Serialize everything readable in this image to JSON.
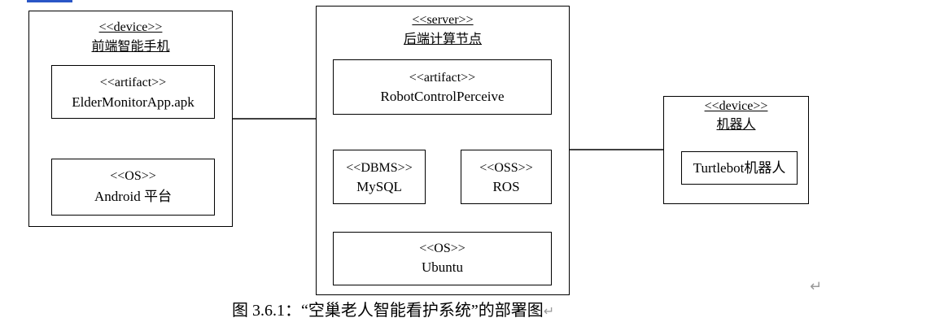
{
  "diagram": {
    "device_left": {
      "stereotype": "<<device>>",
      "name": "前端智能手机",
      "artifact": {
        "stereotype": "<<artifact>>",
        "name": "ElderMonitorApp.apk"
      },
      "os": {
        "stereotype": "<<OS>>",
        "name": "Android 平台"
      }
    },
    "server": {
      "stereotype": "<<server>>",
      "name": "后端计算节点",
      "artifact": {
        "stereotype": "<<artifact>>",
        "name": "RobotControlPerceive"
      },
      "dbms": {
        "stereotype": "<<DBMS>>",
        "name": "MySQL"
      },
      "oss": {
        "stereotype": "<<OSS>>",
        "name": "ROS"
      },
      "os": {
        "stereotype": "<<OS>>",
        "name": "Ubuntu"
      }
    },
    "device_right": {
      "stereotype": "<<device>>",
      "name": "机器人",
      "component": {
        "name": "Turtlebot机器人"
      }
    }
  },
  "caption": "图 3.6.1：“空巢老人智能看护系统”的部署图",
  "return_mark": "↵",
  "colors": {
    "line": "#000000",
    "top_bar": "#2a56c6",
    "return_mark": "#9a9a9a"
  }
}
